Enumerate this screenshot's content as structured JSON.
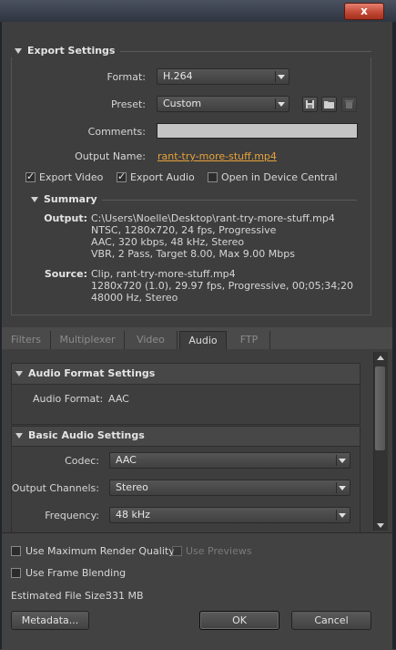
{
  "window": {
    "close_glyph": "x"
  },
  "export_settings": {
    "title": "Export Settings",
    "format_label": "Format:",
    "format_value": "H.264",
    "preset_label": "Preset:",
    "preset_value": "Custom",
    "comments_label": "Comments:",
    "comments_value": "",
    "output_name_label": "Output Name:",
    "output_name_value": "rant-try-more-stuff.mp4",
    "export_video_label": "Export Video",
    "export_video_checked": true,
    "export_audio_label": "Export Audio",
    "export_audio_checked": true,
    "device_central_label": "Open in Device Central",
    "device_central_checked": false
  },
  "summary": {
    "title": "Summary",
    "output_label": "Output:",
    "output_lines": [
      "C:\\Users\\Noelle\\Desktop\\rant-try-more-stuff.mp4",
      "NTSC, 1280x720, 24 fps, Progressive",
      "AAC, 320 kbps, 48 kHz, Stereo",
      "VBR, 2 Pass, Target 8.00, Max 9.00 Mbps"
    ],
    "source_label": "Source:",
    "source_lines": [
      "Clip, rant-try-more-stuff.mp4",
      "1280x720 (1.0), 29.97 fps, Progressive, 00;05;34;20",
      "48000 Hz, Stereo"
    ]
  },
  "tabs": [
    {
      "label": "Filters",
      "active": false
    },
    {
      "label": "Multiplexer",
      "active": false
    },
    {
      "label": "Video",
      "active": false
    },
    {
      "label": "Audio",
      "active": true
    },
    {
      "label": "FTP",
      "active": false
    }
  ],
  "audio": {
    "format_section_title": "Audio Format Settings",
    "format_label": "Audio Format:",
    "format_value": "AAC",
    "basic_section_title": "Basic Audio Settings",
    "codec_label": "Codec:",
    "codec_value": "AAC",
    "channels_label": "Output Channels:",
    "channels_value": "Stereo",
    "frequency_label": "Frequency:",
    "frequency_value": "48 kHz"
  },
  "bottom": {
    "max_quality_label": "Use Maximum Render Quality",
    "max_quality_checked": false,
    "previews_label": "Use Previews",
    "previews_checked": false,
    "frame_blending_label": "Use Frame Blending",
    "frame_blending_checked": false,
    "file_size_label": "Estimated File Size:",
    "file_size_value": "331 MB",
    "metadata_button": "Metadata...",
    "ok_button": "OK",
    "cancel_button": "Cancel"
  },
  "colors": {
    "link": "#e8a33a",
    "accent_close": "#c24a36"
  }
}
